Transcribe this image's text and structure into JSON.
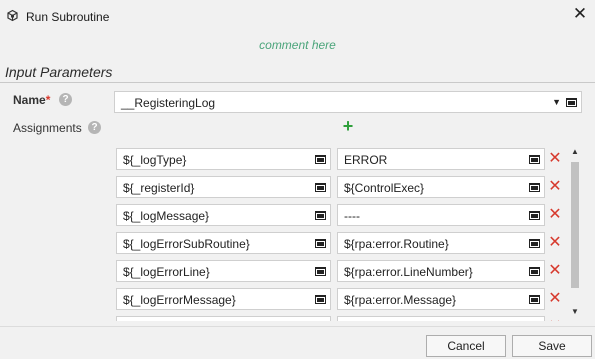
{
  "window": {
    "title": "Run Subroutine",
    "close_label": "✕"
  },
  "comment": "comment here",
  "section": {
    "title": "Input Parameters"
  },
  "name": {
    "label": "Name",
    "required_marker": "*",
    "value": "__RegisteringLog"
  },
  "assignments": {
    "label": "Assignments",
    "add_label": "+",
    "delete_label": "✕",
    "rows": [
      {
        "param": "${_logType}",
        "value": "ERROR"
      },
      {
        "param": "${_registerId}",
        "value": "${ControlExec}"
      },
      {
        "param": "${_logMessage}",
        "value": "----"
      },
      {
        "param": "${_logErrorSubRoutine}",
        "value": "${rpa:error.Routine}"
      },
      {
        "param": "${_logErrorLine}",
        "value": "${rpa:error.LineNumber}"
      },
      {
        "param": "${_logErrorMessage}",
        "value": "${rpa:error.Message}"
      },
      {
        "param": "",
        "value": ""
      }
    ]
  },
  "help_label": "?",
  "buttons": {
    "cancel": "Cancel",
    "save": "Save"
  },
  "icons": {
    "app": "subroutine-icon",
    "help": "help-circle-icon",
    "field": "console-icon",
    "delete": "delete-x-icon",
    "add": "plus-icon"
  },
  "colors": {
    "accent_green": "#2fa03c",
    "comment_green": "#4aa47a",
    "delete_red": "#d73a2e",
    "required_red": "#d9372b"
  }
}
